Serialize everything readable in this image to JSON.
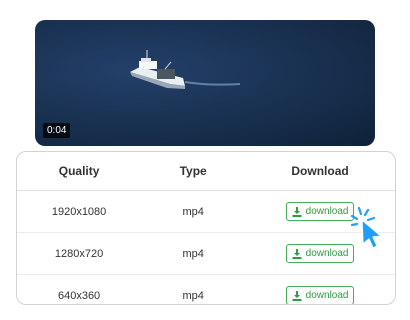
{
  "video": {
    "duration": "0:04"
  },
  "table": {
    "headers": {
      "quality": "Quality",
      "type": "Type",
      "download": "Download"
    },
    "rows": [
      {
        "quality": "1920x1080",
        "type": "mp4",
        "action": "download"
      },
      {
        "quality": "1280x720",
        "type": "mp4",
        "action": "download"
      },
      {
        "quality": "640x360",
        "type": "mp4",
        "action": "download"
      }
    ]
  },
  "colors": {
    "accent": "#2c9d44",
    "cursor": "#1ea0ff"
  },
  "icons": {
    "download": "download-icon",
    "cursor": "pointer-cursor-icon"
  }
}
